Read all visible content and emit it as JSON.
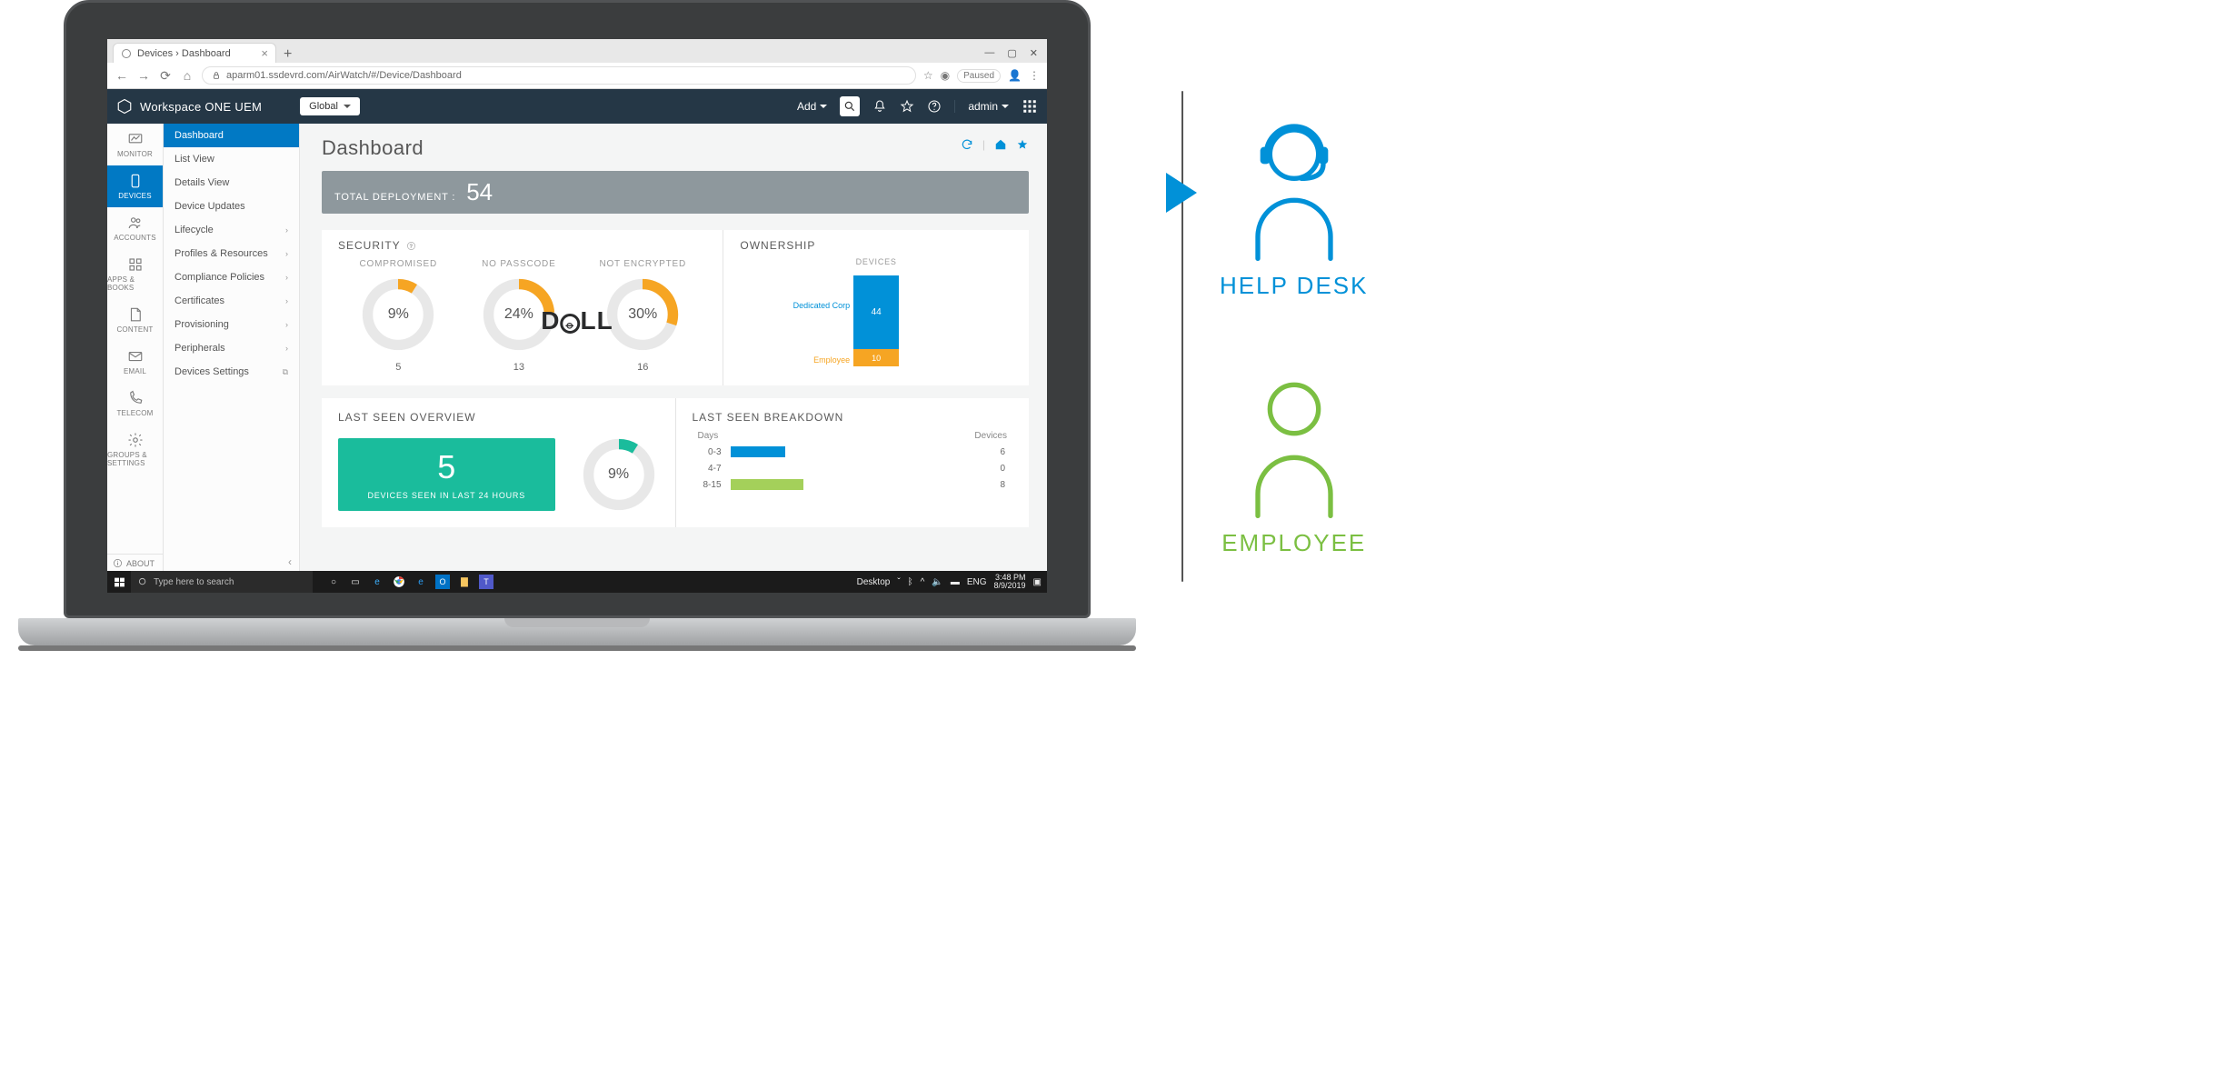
{
  "browser": {
    "tab_title": "Devices › Dashboard",
    "url": "aparm01.ssdevrd.com/AirWatch/#/Device/Dashboard",
    "paused_label": "Paused"
  },
  "header": {
    "brand": "Workspace ONE UEM",
    "scope": "Global",
    "add_label": "Add",
    "admin_label": "admin"
  },
  "rail": {
    "items": [
      {
        "id": "monitor",
        "label": "MONITOR"
      },
      {
        "id": "devices",
        "label": "DEVICES"
      },
      {
        "id": "accounts",
        "label": "ACCOUNTS"
      },
      {
        "id": "apps",
        "label": "APPS & BOOKS"
      },
      {
        "id": "content",
        "label": "CONTENT"
      },
      {
        "id": "email",
        "label": "EMAIL"
      },
      {
        "id": "telecom",
        "label": "TELECOM"
      },
      {
        "id": "groups",
        "label": "GROUPS & SETTINGS"
      }
    ],
    "about": "ABOUT"
  },
  "subnav": {
    "items": [
      {
        "label": "Dashboard",
        "active": true,
        "expand": false
      },
      {
        "label": "List View",
        "expand": false
      },
      {
        "label": "Details View",
        "expand": false
      },
      {
        "label": "Device Updates",
        "expand": false
      },
      {
        "label": "Lifecycle",
        "expand": true
      },
      {
        "label": "Profiles & Resources",
        "expand": true
      },
      {
        "label": "Compliance Policies",
        "expand": true
      },
      {
        "label": "Certificates",
        "expand": true
      },
      {
        "label": "Provisioning",
        "expand": true
      },
      {
        "label": "Peripherals",
        "expand": true
      },
      {
        "label": "Devices Settings",
        "expand": false,
        "ext": true
      }
    ]
  },
  "page": {
    "title": "Dashboard",
    "deployment_label": "TOTAL DEPLOYMENT :",
    "deployment_value": "54"
  },
  "security": {
    "title": "SECURITY",
    "compromised": {
      "title": "COMPROMISED",
      "pct": "9%",
      "pct_num": 9,
      "count": "5"
    },
    "no_passcode": {
      "title": "NO PASSCODE",
      "pct": "24%",
      "pct_num": 24,
      "count": "13"
    },
    "not_encrypted": {
      "title": "NOT ENCRYPTED",
      "pct": "30%",
      "pct_num": 30,
      "count": "16"
    }
  },
  "ownership": {
    "title": "OWNERSHIP",
    "axis_label": "DEVICES",
    "corp": {
      "label": "Dedicated Corp",
      "value": "44"
    },
    "emp": {
      "label": "Employee",
      "value": "10"
    }
  },
  "last_seen": {
    "overview_title": "LAST SEEN OVERVIEW",
    "breakdown_title": "LAST SEEN BREAKDOWN",
    "overview_count": "5",
    "overview_caption": "DEVICES SEEN IN LAST 24 HOURS",
    "overview_ring_pct": "9%",
    "days_label": "Days",
    "devices_label": "Devices",
    "rows": [
      {
        "range": "0-3",
        "devices": "6",
        "color": "#0191d8",
        "w": 60
      },
      {
        "range": "4-7",
        "devices": "0",
        "color": "#0191d8",
        "w": 0
      },
      {
        "range": "8-15",
        "devices": "8",
        "color": "#a4d05a",
        "w": 80
      }
    ]
  },
  "taskbar": {
    "search_placeholder": "Type here to search",
    "desktop_label": "Desktop",
    "lang": "ENG",
    "time": "3:48 PM",
    "date": "8/9/2019"
  },
  "personas": {
    "helpdesk": "HELP DESK",
    "employee": "EMPLOYEE"
  },
  "chart_data": [
    {
      "type": "pie",
      "title": "COMPROMISED",
      "values": [
        9,
        91
      ],
      "categories": [
        "compromised",
        "ok"
      ],
      "center_label": "9%",
      "count": 5
    },
    {
      "type": "pie",
      "title": "NO PASSCODE",
      "values": [
        24,
        76
      ],
      "categories": [
        "no_passcode",
        "ok"
      ],
      "center_label": "24%",
      "count": 13
    },
    {
      "type": "pie",
      "title": "NOT ENCRYPTED",
      "values": [
        30,
        70
      ],
      "categories": [
        "not_encrypted",
        "ok"
      ],
      "center_label": "30%",
      "count": 16
    },
    {
      "type": "bar",
      "title": "OWNERSHIP — DEVICES",
      "categories": [
        "Dedicated Corp",
        "Employee"
      ],
      "values": [
        44,
        10
      ],
      "ylim": [
        0,
        54
      ],
      "stacked": true
    },
    {
      "type": "pie",
      "title": "LAST SEEN OVERVIEW",
      "values": [
        9,
        91
      ],
      "categories": [
        "seen_24h_pct",
        "other"
      ],
      "center_label": "9%",
      "annotation": "5 devices seen in last 24 hours"
    },
    {
      "type": "bar",
      "title": "LAST SEEN BREAKDOWN",
      "xlabel": "Days",
      "ylabel": "Devices",
      "categories": [
        "0-3",
        "4-7",
        "8-15"
      ],
      "values": [
        6,
        0,
        8
      ],
      "orientation": "horizontal"
    }
  ]
}
